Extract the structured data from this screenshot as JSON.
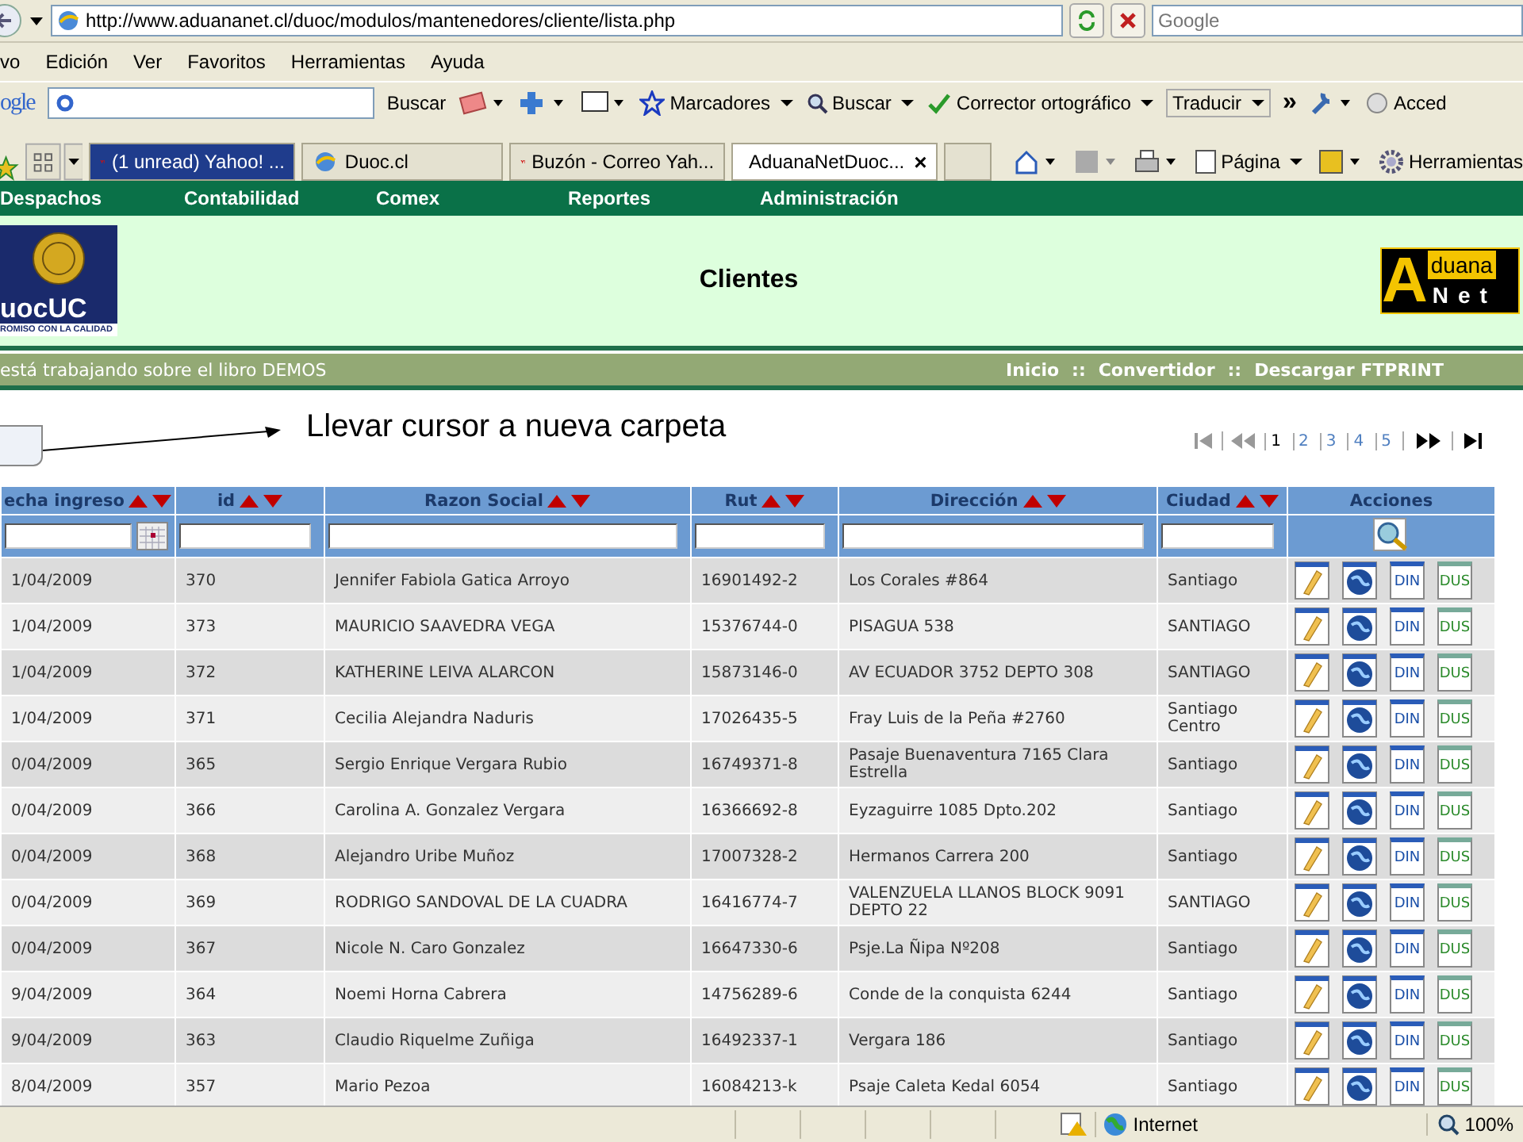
{
  "browser": {
    "url": "http://www.aduananet.cl/duoc/modulos/mantenedores/cliente/lista.php",
    "search_placeholder": "Google",
    "menu": [
      "vo",
      "Edición",
      "Ver",
      "Favoritos",
      "Herramientas",
      "Ayuda"
    ],
    "google_logo": "ogle",
    "toolbar": [
      "Buscar",
      "Marcadores",
      "Buscar",
      "Corrector ortográfico",
      "Traducir",
      "»",
      "Acced"
    ],
    "tabs": [
      {
        "label": "(1 unread) Yahoo! ...",
        "selected": false,
        "highlighted": true
      },
      {
        "label": "Duoc.cl",
        "selected": false,
        "highlighted": false
      },
      {
        "label": "Buzón - Correo Yah...",
        "selected": false,
        "highlighted": false
      },
      {
        "label": "AduanaNetDuoc...",
        "selected": true,
        "highlighted": false,
        "close": "×"
      }
    ],
    "command_bar": [
      "Página",
      "Herramientas"
    ],
    "status": {
      "zone": "Internet",
      "zoom": "100%"
    }
  },
  "nav": [
    "Despachos",
    "Contabilidad",
    "Comex",
    "Reportes",
    "Administración"
  ],
  "header": {
    "title": "Clientes",
    "left_logo": {
      "name": "uocUC",
      "motto": "ROMISO CON LA CALIDAD"
    },
    "right_logo": {
      "letter": "A",
      "top": "duana",
      "bottom": "Net"
    }
  },
  "info_bar": {
    "text": "está trabajando sobre el libro DEMOS",
    "links": [
      "Inicio",
      "Convertidor",
      "Descargar FTPRINT"
    ],
    "separator": "::"
  },
  "annotation": "Llevar cursor a nueva carpeta",
  "pagination": [
    {
      "label": "1",
      "selected": true
    },
    {
      "label": "2",
      "selected": false
    },
    {
      "label": "3",
      "selected": false
    },
    {
      "label": "4",
      "selected": false
    },
    {
      "label": "5",
      "selected": false
    }
  ],
  "table": {
    "columns": [
      {
        "label": "echa ingreso",
        "sortable": true,
        "kind": "date"
      },
      {
        "label": "id",
        "sortable": true,
        "kind": "text"
      },
      {
        "label": "Razon Social",
        "sortable": true,
        "kind": "text"
      },
      {
        "label": "Rut",
        "sortable": true,
        "kind": "text"
      },
      {
        "label": "Dirección",
        "sortable": true,
        "kind": "text"
      },
      {
        "label": "Ciudad",
        "sortable": true,
        "kind": "text"
      },
      {
        "label": "Acciones",
        "sortable": false,
        "kind": "search"
      }
    ],
    "rows": [
      {
        "cells": [
          "1/04/2009",
          "370",
          "Jennifer Fabiola Gatica Arroyo",
          "16901492-2",
          "Los Corales #864",
          "Santiago"
        ],
        "din": "DIN",
        "dus": "DUS"
      },
      {
        "cells": [
          "1/04/2009",
          "373",
          "MAURICIO SAAVEDRA VEGA",
          "15376744-0",
          "PISAGUA 538",
          "SANTIAGO"
        ],
        "din": "DIN",
        "dus": "DUS"
      },
      {
        "cells": [
          "1/04/2009",
          "372",
          "KATHERINE LEIVA ALARCON",
          "15873146-0",
          "AV ECUADOR 3752 DEPTO 308",
          "SANTIAGO"
        ],
        "din": "DIN",
        "dus": "DUS"
      },
      {
        "cells": [
          "1/04/2009",
          "371",
          "Cecilia Alejandra Naduris",
          "17026435-5",
          "Fray Luis de la Peña #2760",
          "Santiago Centro"
        ],
        "din": "DIN",
        "dus": "DUS"
      },
      {
        "cells": [
          "0/04/2009",
          "365",
          "Sergio Enrique Vergara Rubio",
          "16749371-8",
          "Pasaje Buenaventura 7165 Clara Estrella",
          "Santiago"
        ],
        "din": "DIN",
        "dus": "DUS"
      },
      {
        "cells": [
          "0/04/2009",
          "366",
          "Carolina A. Gonzalez Vergara",
          "16366692-8",
          "Eyzaguirre 1085 Dpto.202",
          "Santiago"
        ],
        "din": "DIN",
        "dus": "DUS"
      },
      {
        "cells": [
          "0/04/2009",
          "368",
          "Alejandro Uribe Muñoz",
          "17007328-2",
          "Hermanos Carrera 200",
          "Santiago"
        ],
        "din": "DIN",
        "dus": "DUS"
      },
      {
        "cells": [
          "0/04/2009",
          "369",
          "RODRIGO SANDOVAL DE LA CUADRA",
          "16416774-7",
          "VALENZUELA LLANOS BLOCK 9091 DEPTO 22",
          "SANTIAGO"
        ],
        "din": "DIN",
        "dus": "DUS"
      },
      {
        "cells": [
          "0/04/2009",
          "367",
          "Nicole N. Caro Gonzalez",
          "16647330-6",
          "Psje.La Ñipa Nº208",
          "Santiago"
        ],
        "din": "DIN",
        "dus": "DUS"
      },
      {
        "cells": [
          "9/04/2009",
          "364",
          "Noemi Horna Cabrera",
          "14756289-6",
          "Conde de la conquista 6244",
          "Santiago"
        ],
        "din": "DIN",
        "dus": "DUS"
      },
      {
        "cells": [
          "9/04/2009",
          "363",
          "Claudio Riquelme Zuñiga",
          "16492337-1",
          "Vergara 186",
          "Santiago"
        ],
        "din": "DIN",
        "dus": "DUS"
      },
      {
        "cells": [
          "8/04/2009",
          "357",
          "Mario Pezoa",
          "16084213-k",
          "Psaje Caleta Kedal 6054",
          "Santiago"
        ],
        "din": "DIN",
        "dus": "DUS"
      }
    ]
  }
}
